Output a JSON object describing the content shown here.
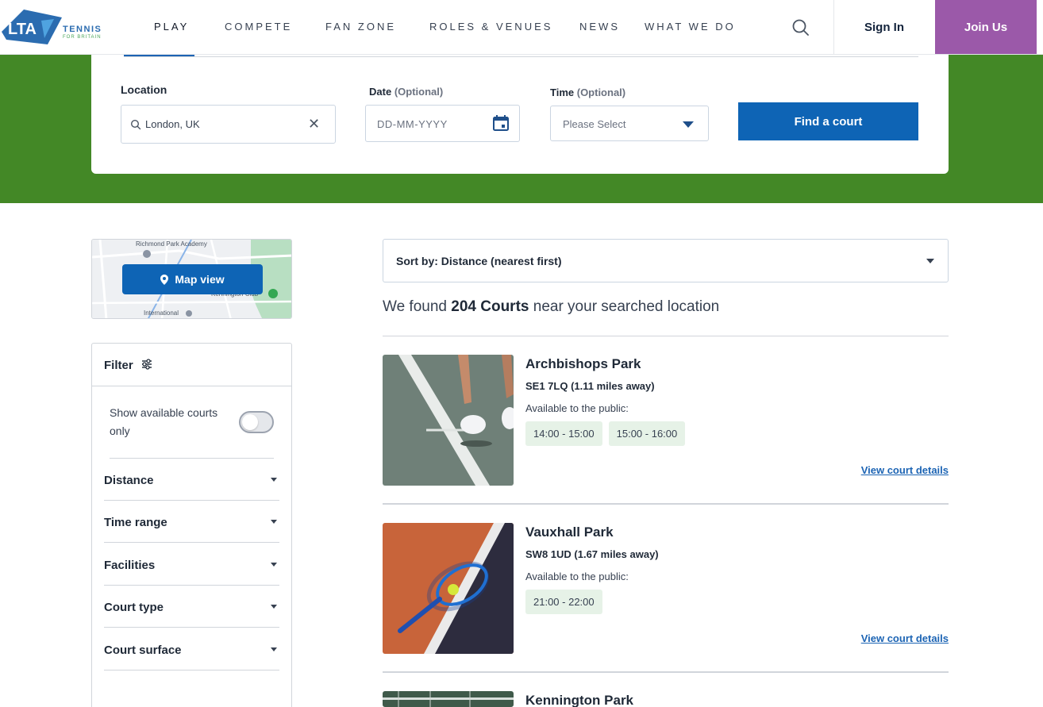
{
  "header": {
    "logo_text": "LTA",
    "logo_tennis": "TENNIS",
    "logo_sub": "FOR BRITAIN",
    "nav": [
      "PLAY",
      "COMPETE",
      "FAN ZONE",
      "ROLES & VENUES",
      "NEWS",
      "WHAT WE DO"
    ],
    "active_nav": "PLAY",
    "sign_in": "Sign In",
    "join_us": "Join Us",
    "join_color": "#9b59a9"
  },
  "search": {
    "location_label": "Location",
    "location_value": "London, UK",
    "date_label": "Date",
    "date_optional": "(Optional)",
    "date_placeholder": "DD-MM-YYYY",
    "time_label": "Time",
    "time_optional": "(Optional)",
    "time_placeholder": "Please Select",
    "find_button": "Find a court",
    "brand_green": "#438826",
    "brand_blue": "#0e64b5"
  },
  "map": {
    "button": "Map view",
    "labels": [
      "Richmond Park Academy",
      "Kennington Club",
      "International"
    ]
  },
  "filter": {
    "title": "Filter",
    "available_only": "Show available courts only",
    "available_toggle": false,
    "sections": [
      "Distance",
      "Time range",
      "Facilities",
      "Court type",
      "Court surface"
    ]
  },
  "results": {
    "sort_label": "Sort by: Distance (nearest first)",
    "found_prefix": "We found",
    "found_count": "204 Courts",
    "found_suffix": "near your searched location",
    "courts": [
      {
        "name": "Archbishops Park",
        "postcode": "SE1 7LQ (1.11 miles away)",
        "available": "Available to the public:",
        "slots": [
          "14:00 - 15:00",
          "15:00 - 16:00"
        ],
        "details": "View court details"
      },
      {
        "name": "Vauxhall Park",
        "postcode": "SW8 1UD (1.67 miles away)",
        "available": "Available to the public:",
        "slots": [
          "21:00 - 22:00"
        ],
        "details": "View court details"
      },
      {
        "name": "Kennington Park"
      }
    ]
  }
}
